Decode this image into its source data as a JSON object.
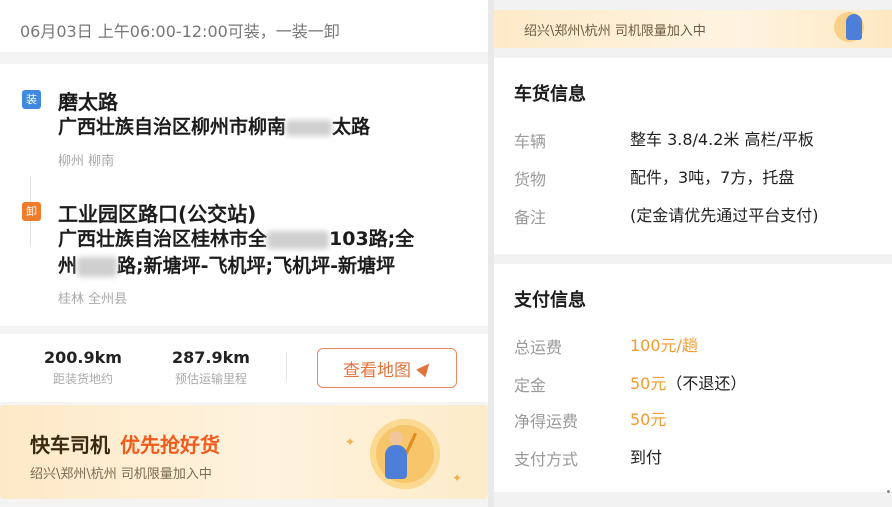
{
  "schedule": {
    "text": "06月03日 上午06:00-12:00可装，一装一卸"
  },
  "load_stop": {
    "tag": "装",
    "name": "磨太路",
    "address_prefix": "广西壮族自治区柳州市柳南",
    "address_suffix": "太路",
    "city": "柳州 柳南"
  },
  "unload_stop": {
    "tag": "卸",
    "name": "工业园区路口(公交站)",
    "address_line1_prefix": "广西壮族自治区桂林市全",
    "address_line1_suffix": "103路;全",
    "address_line2_prefix": "州",
    "address_line2_suffix": "路;新塘坪-飞机坪;飞机坪-新塘坪",
    "city": "桂林 全州县"
  },
  "distance": {
    "to_load_value": "200.9km",
    "to_load_label": "距装货地约",
    "route_value": "287.9km",
    "route_label": "预估运输里程",
    "map_button": "查看地图"
  },
  "promo_banner": {
    "title": "快车司机",
    "highlight": "优先抢好货",
    "subtitle": "绍兴\\郑州\\杭州 司机限量加入中"
  },
  "top_banner": {
    "text": "绍兴\\郑州\\杭州 司机限量加入中"
  },
  "cargo_info": {
    "title": "车货信息",
    "rows": [
      {
        "label": "车辆",
        "value": "整车 3.8/4.2米 高栏/平板"
      },
      {
        "label": "货物",
        "value": "配件，3吨，7方，托盘"
      },
      {
        "label": "备注",
        "value": "(定金请优先通过平台支付)"
      }
    ]
  },
  "payment_info": {
    "title": "支付信息",
    "rows": [
      {
        "label": "总运费",
        "value": "100元/趟",
        "extra": ""
      },
      {
        "label": "定金",
        "value": "50元",
        "extra": "（不退还）"
      },
      {
        "label": "净得运费",
        "value": "50元",
        "extra": ""
      },
      {
        "label": "支付方式",
        "value": "到付",
        "extra": ""
      }
    ]
  },
  "colors": {
    "accent_orange": "#f29b2f",
    "load_blue": "#3f8ae0",
    "unload_orange": "#f07c2a"
  },
  "icons": [
    "navigation-arrow-icon",
    "clock-illustration-icon",
    "runner-illustration-icon"
  ]
}
